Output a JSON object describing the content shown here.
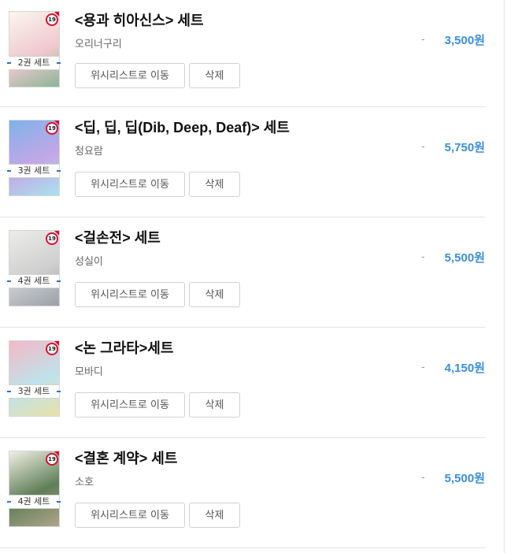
{
  "items": [
    {
      "title": "<용과 히아신스> 세트",
      "author": "오리너구리",
      "dash": "-",
      "price": "3,500원",
      "set_count": "2권 세트",
      "age": "19",
      "wishlist_label": "위시리스트로 이동",
      "delete_label": "삭제",
      "cover_colors": [
        "#fbf6ef",
        "#f0c9cf",
        "#8bb596"
      ]
    },
    {
      "title": "<딥, 딥, 딥(Dib, Deep, Deaf)> 세트",
      "author": "청요람",
      "dash": "-",
      "price": "5,750원",
      "set_count": "3권 세트",
      "age": "19",
      "wishlist_label": "위시리스트로 이동",
      "delete_label": "삭제",
      "cover_colors": [
        "#7fb2ea",
        "#c3a7e6",
        "#a9e2ee"
      ]
    },
    {
      "title": "<걸손전> 세트",
      "author": "성실이",
      "dash": "-",
      "price": "5,500원",
      "set_count": "4권 세트",
      "age": "19",
      "wishlist_label": "위시리스트로 이동",
      "delete_label": "삭제",
      "cover_colors": [
        "#ececea",
        "#cfcfcf",
        "#9aa0a8"
      ]
    },
    {
      "title": "<논 그라타>세트",
      "author": "모바디",
      "dash": "-",
      "price": "4,150원",
      "set_count": "3권 세트",
      "age": "19",
      "wishlist_label": "위시리스트로 이동",
      "delete_label": "삭제",
      "cover_colors": [
        "#f4b8c6",
        "#bfe2ea",
        "#e9e1a8"
      ]
    },
    {
      "title": "<결혼 계약> 세트",
      "author": "소호",
      "dash": "-",
      "price": "5,500원",
      "set_count": "4권 세트",
      "age": "19",
      "wishlist_label": "위시리스트로 이동",
      "delete_label": "삭제",
      "cover_colors": [
        "#f1efe6",
        "#5f7f57",
        "#b0a58a"
      ]
    }
  ]
}
